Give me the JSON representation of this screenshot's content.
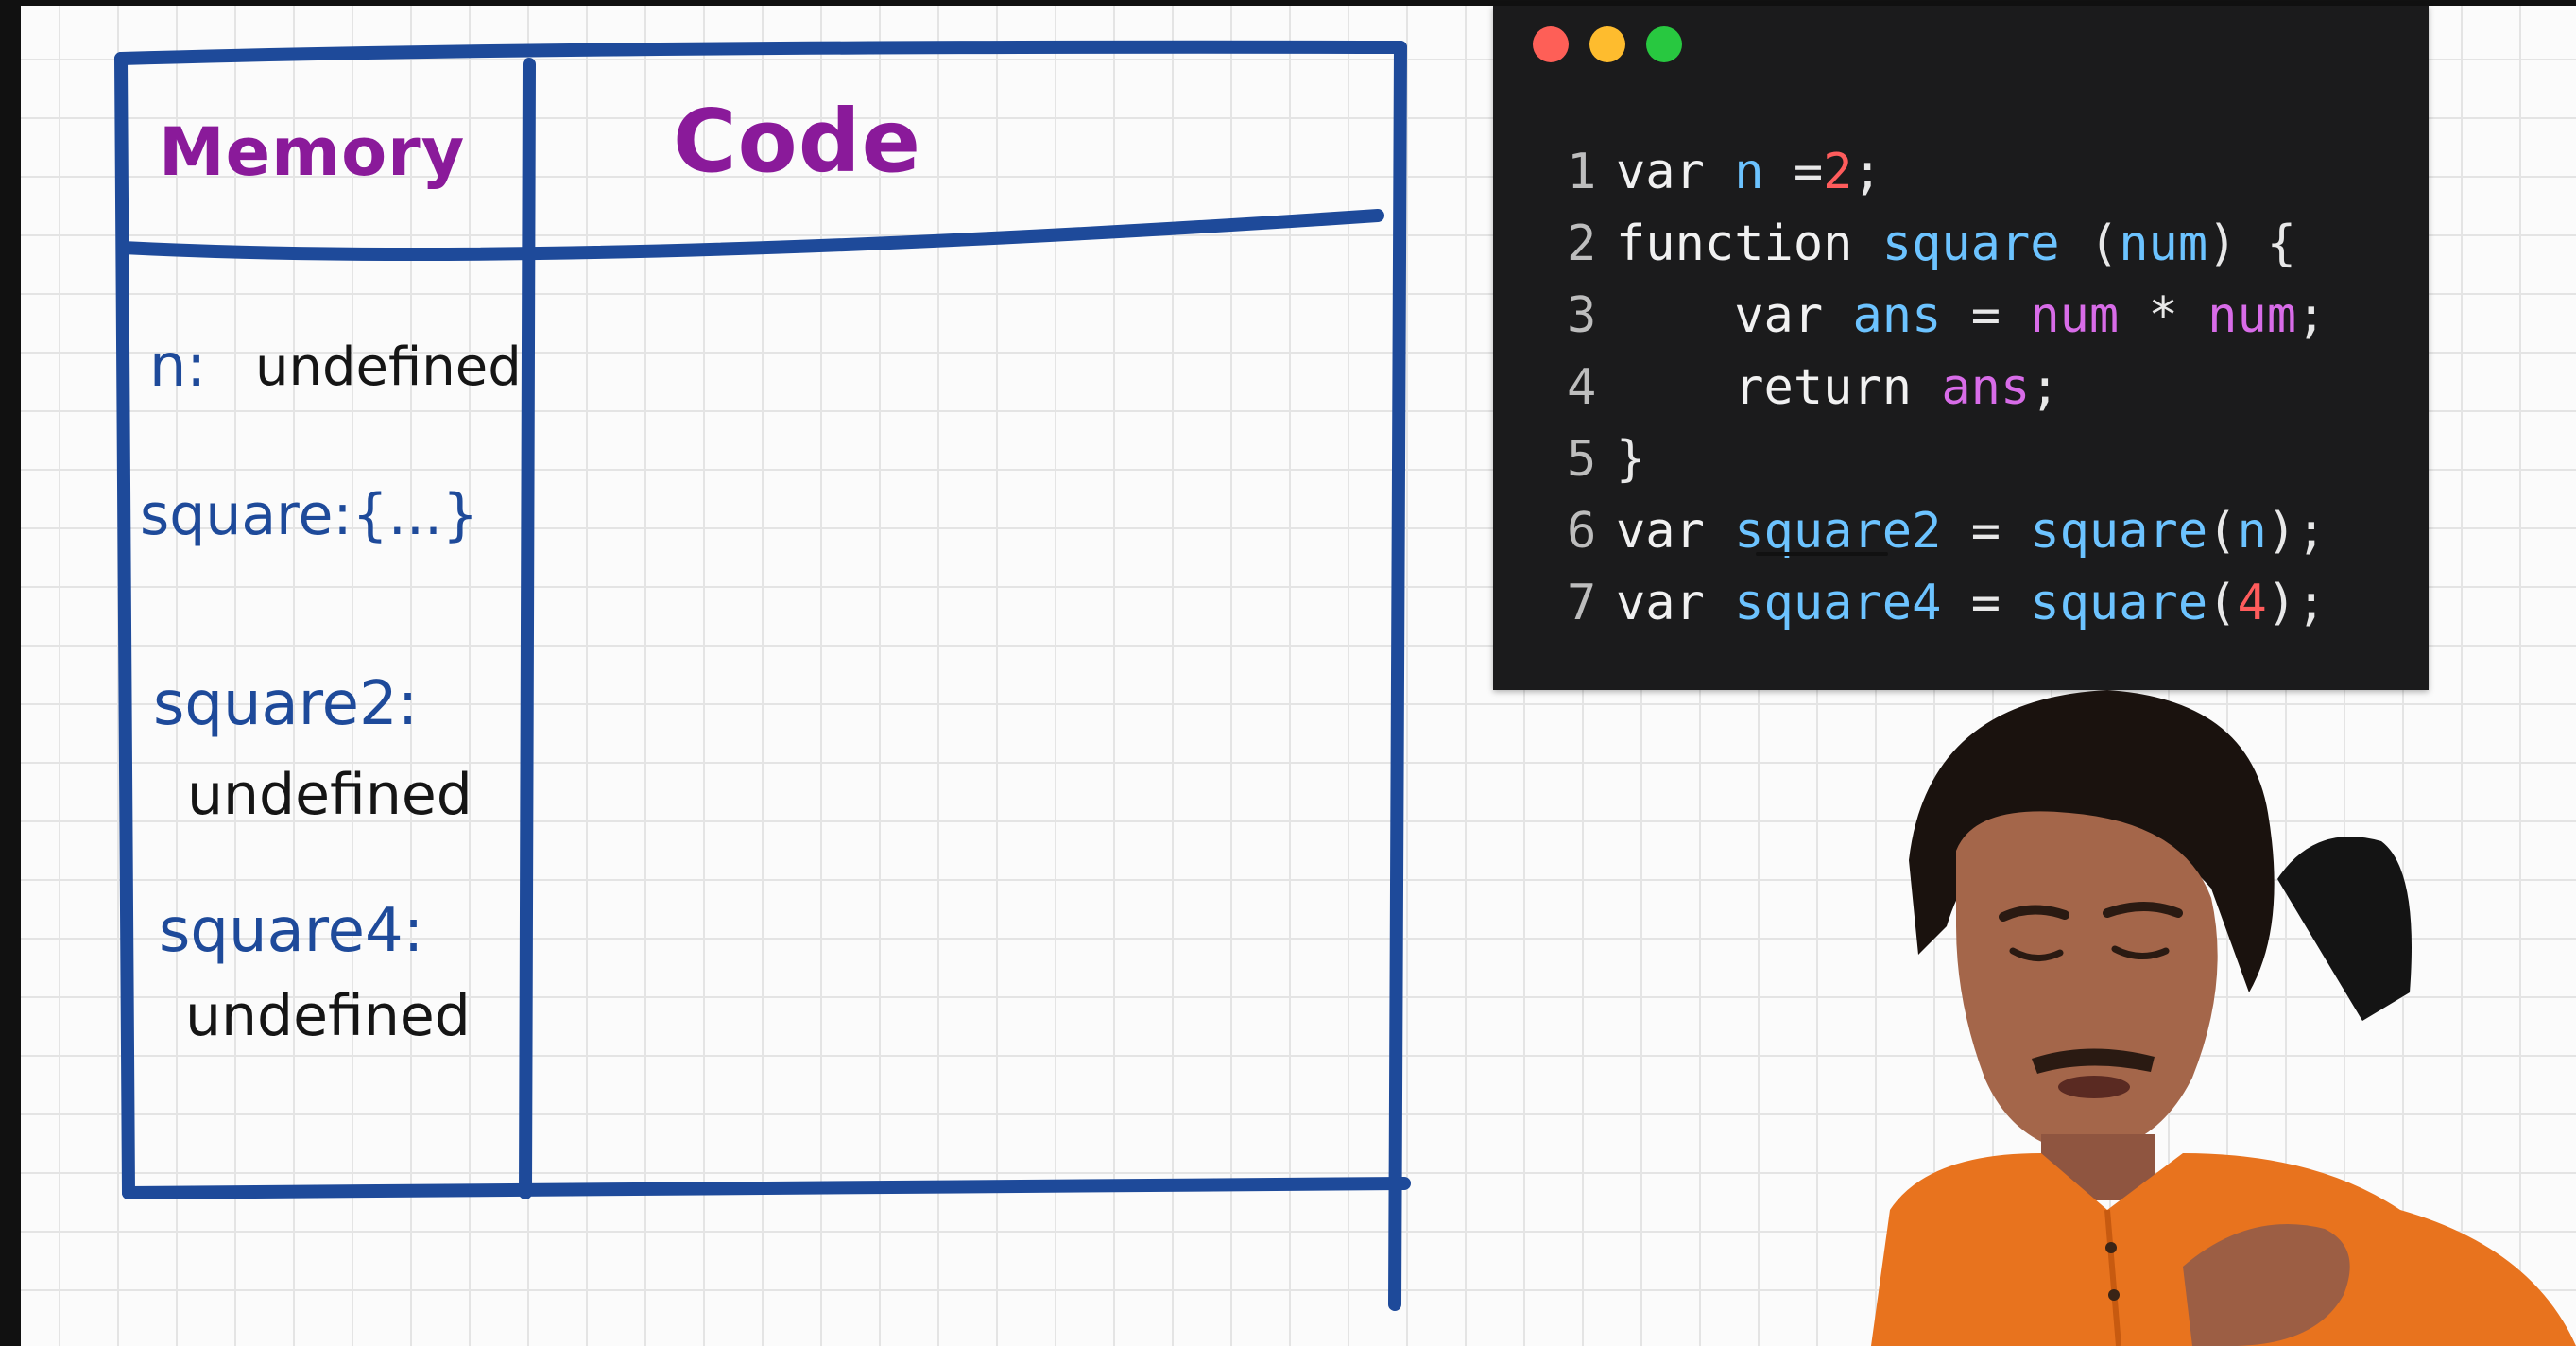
{
  "whiteboard": {
    "headers": {
      "memory": "Memory",
      "code": "Code"
    },
    "memory_entries": {
      "n": "n:",
      "n_value": "undefined",
      "square": "square:{...}",
      "square2": "square2:",
      "square2_value": "undefined",
      "square4": "square4:",
      "square4_value": "undefined"
    }
  },
  "editor": {
    "lines": [
      {
        "no": "1",
        "tokens": [
          [
            "kw",
            "var "
          ],
          [
            "id",
            "n "
          ],
          [
            "op",
            "="
          ],
          [
            "num",
            "2"
          ],
          [
            "op",
            ";"
          ]
        ]
      },
      {
        "no": "2",
        "tokens": [
          [
            "kw",
            "function "
          ],
          [
            "fn",
            "square "
          ],
          [
            "op",
            "("
          ],
          [
            "id",
            "num"
          ],
          [
            "op",
            ") {"
          ]
        ]
      },
      {
        "no": "3",
        "tokens": [
          [
            "kw",
            "    var "
          ],
          [
            "id",
            "ans "
          ],
          [
            "op",
            "= "
          ],
          [
            "par",
            "num "
          ],
          [
            "op",
            "* "
          ],
          [
            "par",
            "num"
          ],
          [
            "op",
            ";"
          ]
        ]
      },
      {
        "no": "4",
        "tokens": [
          [
            "kw",
            "    return "
          ],
          [
            "par",
            "ans"
          ],
          [
            "op",
            ";"
          ]
        ]
      },
      {
        "no": "5",
        "tokens": [
          [
            "op",
            "}"
          ]
        ]
      },
      {
        "no": "6",
        "tokens": [
          [
            "kw",
            "var "
          ],
          [
            "id",
            "square2 "
          ],
          [
            "op",
            "= "
          ],
          [
            "fn",
            "square"
          ],
          [
            "op",
            "("
          ],
          [
            "id",
            "n"
          ],
          [
            "op",
            ");"
          ]
        ]
      },
      {
        "no": "7",
        "tokens": [
          [
            "kw",
            "var "
          ],
          [
            "id",
            "square4 "
          ],
          [
            "op",
            "= "
          ],
          [
            "fn",
            "square"
          ],
          [
            "op",
            "("
          ],
          [
            "num",
            "4"
          ],
          [
            "op",
            ");"
          ]
        ]
      }
    ],
    "traffic_lights": {
      "red": "#fe5f57",
      "yellow": "#febc2e",
      "green": "#28c840"
    }
  },
  "colors": {
    "table_ink": "#1e4a9a",
    "header_ink": "#8a1a9a",
    "presenter_shirt": "#e8731e"
  }
}
